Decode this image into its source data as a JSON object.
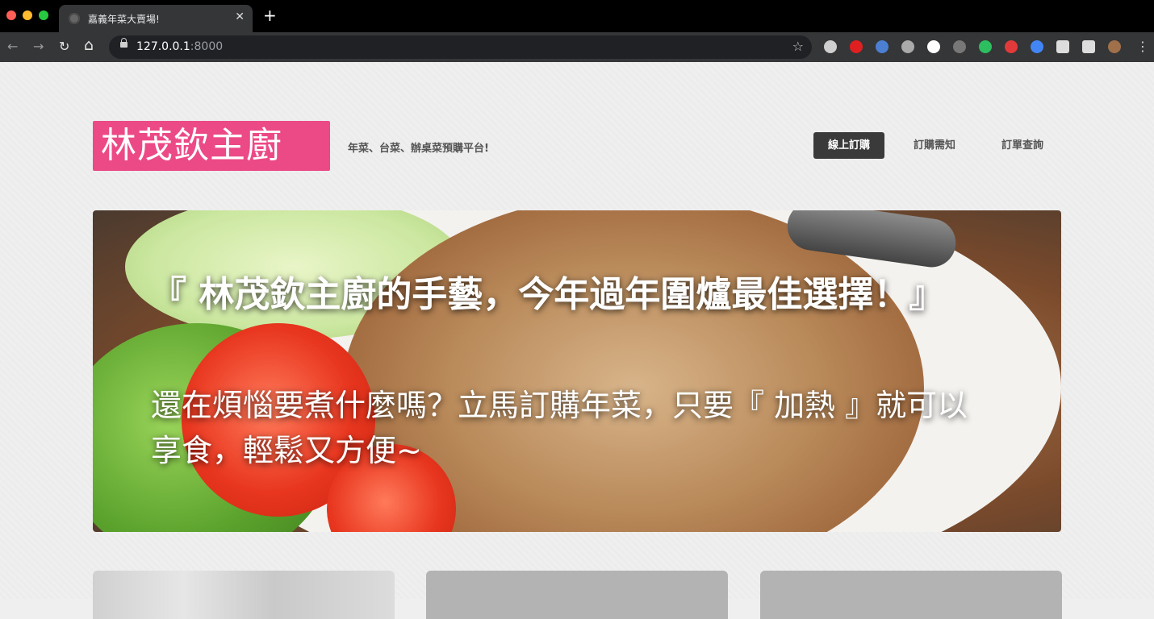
{
  "browser": {
    "tab_title": "嘉義年菜大賣場!",
    "tab_close": "✕",
    "new_tab": "+",
    "url_host": "127.0.0.1",
    "url_port": ":8000",
    "back": "←",
    "forward": "→",
    "reload": "↻",
    "home": "⌂",
    "bookmark": "☆",
    "menu": "⋮",
    "extensions": [
      {
        "icon": "gear-extension-icon",
        "color": "#cfcfcf"
      },
      {
        "icon": "adblock-extension-icon",
        "color": "#e02020"
      },
      {
        "icon": "download-extension-icon",
        "color": "#4a7fd1"
      },
      {
        "icon": "vue-extension-icon",
        "color": "#aaaaaa"
      },
      {
        "icon": "circle-extension-icon",
        "color": "#ffffff"
      },
      {
        "icon": "settings-extension-icon",
        "color": "#777777"
      },
      {
        "icon": "evernote-extension-icon",
        "color": "#2dbe60"
      },
      {
        "icon": "pocket-extension-icon",
        "color": "#e23a3a"
      },
      {
        "icon": "translate-extension-icon",
        "color": "#4285f4"
      },
      {
        "icon": "script-extension-icon",
        "color": "#dddddd"
      },
      {
        "icon": "puzzle-extension-icon",
        "color": "#dddddd"
      },
      {
        "icon": "profile-avatar-icon",
        "color": "#a0704a"
      }
    ]
  },
  "site": {
    "logo": "林茂欽主廚",
    "tagline": "年菜、台菜、辦桌菜預購平台!",
    "nav": {
      "order": "線上訂購",
      "notice": "訂購需知",
      "query": "訂單查詢"
    },
    "hero": {
      "title": "『 林茂欽主廚的手藝，今年過年圍爐最佳選擇！』",
      "subtitle": "還在煩惱要煮什麼嗎？立馬訂購年菜，只要『 加熱 』就可以享食，輕鬆又方便~"
    },
    "colors": {
      "logo_bg": "#ec4a86",
      "active_nav_bg": "#3a3a3a"
    }
  }
}
